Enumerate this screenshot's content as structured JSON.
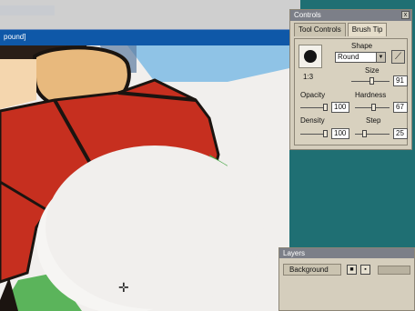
{
  "document": {
    "title_fragment": "pound]"
  },
  "controls": {
    "title": "Controls",
    "close_glyph": "x",
    "tabs": [
      {
        "label": "Tool Controls",
        "active": false
      },
      {
        "label": "Brush Tip",
        "active": true
      }
    ],
    "brush_preview_ratio": "1:3",
    "shape": {
      "label": "Shape",
      "value": "Round"
    },
    "size": {
      "label": "Size",
      "value": "91"
    },
    "opacity": {
      "label": "Opacity",
      "value": "100"
    },
    "hardness": {
      "label": "Hardness",
      "value": "67"
    },
    "density": {
      "label": "Density",
      "value": "100"
    },
    "step": {
      "label": "Step",
      "value": "25"
    }
  },
  "layers": {
    "title": "Layers",
    "rows": [
      {
        "name": "Background"
      }
    ]
  },
  "colors": {
    "desktop": "#1f6f73",
    "titlebar": "#0f58a8",
    "palette_bg": "#d5cebd",
    "palette_title": "#7c7f88"
  },
  "icons": [
    "brush-preview-dot",
    "close-icon",
    "dropdown-arrow-icon",
    "pen-tilt-icon",
    "layer-visibility-icon",
    "layer-lock-icon",
    "crosshair-cursor-icon"
  ]
}
